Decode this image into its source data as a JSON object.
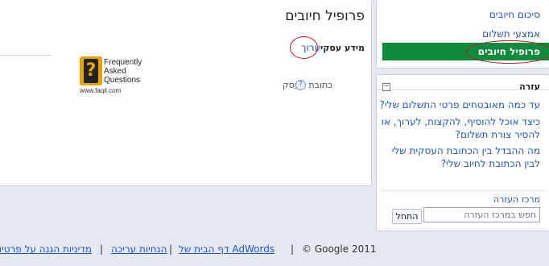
{
  "main": {
    "page_title": "פרופיל חיובים",
    "section_title": "מידע עסקי",
    "edit_link": "ערוך",
    "field_label": "כתובת העסק",
    "help_icon": "?",
    "faq_logo": {
      "line1": "Frequently",
      "line2": "Asked",
      "line3": "Questions",
      "url": "www.faqil.com",
      "mark": "?"
    }
  },
  "nav": {
    "items": [
      {
        "label": "סיכום חיובים"
      },
      {
        "label": "אמצעי תשלום"
      },
      {
        "label": "פרופיל חיובים",
        "active": true
      }
    ]
  },
  "help": {
    "title": "עזרה",
    "collapse_symbol": "−",
    "links": [
      "עד כמה מאובטחים פרטי התשלום שלי?",
      "כיצד אוכל להוסיף, להקצות, לערוך, או להסיר צורת תשלום?",
      "מה ההבדל בין הכתובת העסקית שלי לבין הכתובת לחיוב שלי?"
    ],
    "center_link": "מרכז העזרה",
    "search_placeholder": "חפש במרכז העזרה",
    "go_button": "התחל"
  },
  "footer": {
    "copyright": "© Google 2011",
    "links": [
      "דף הבית של AdWords",
      "הנחיות עריכה",
      "מדיניות הגנה על פרטיות"
    ]
  },
  "colors": {
    "accent_green": "#128a3e",
    "link_blue": "#2255bb",
    "annotation_red": "#b11c2a"
  }
}
